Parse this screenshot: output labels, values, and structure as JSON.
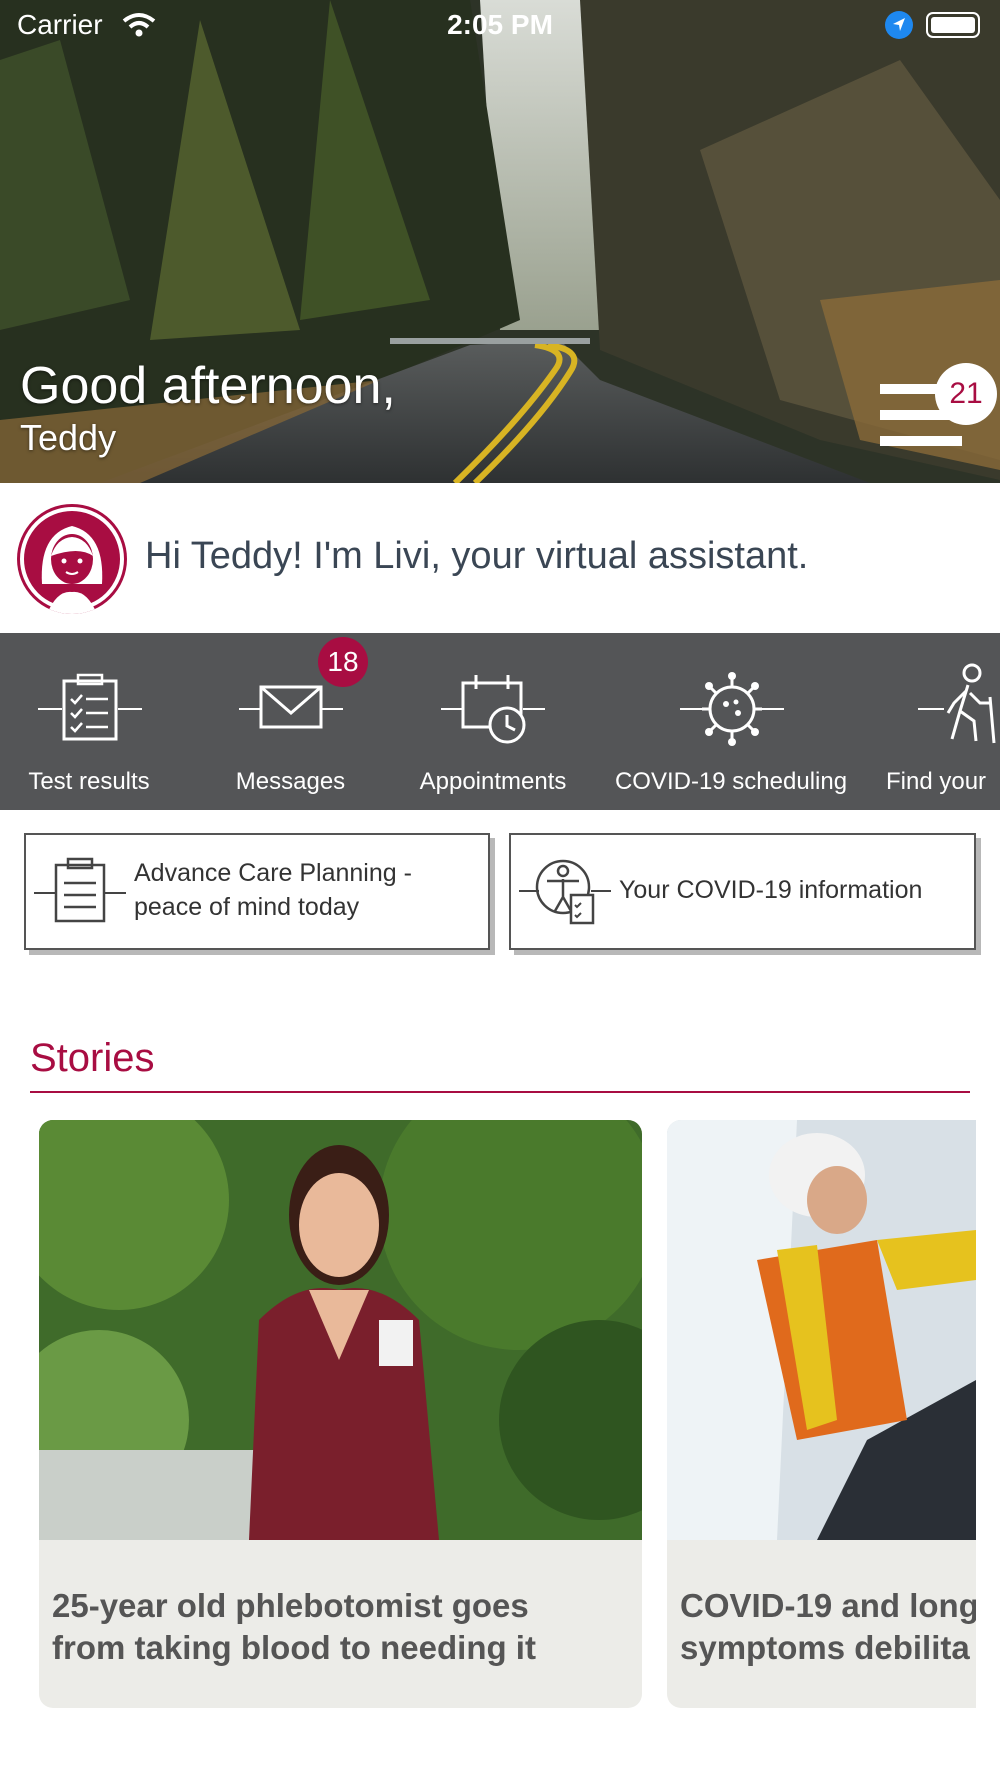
{
  "status_bar": {
    "carrier": "Carrier",
    "time": "2:05 PM"
  },
  "hero": {
    "greeting": "Good afternoon,",
    "name": "Teddy",
    "menu_badge": "21"
  },
  "assistant": {
    "text": "Hi Teddy! I'm Livi, your virtual assistant."
  },
  "quick_actions": [
    {
      "label": "Test results",
      "icon": "clipboard-checklist-icon"
    },
    {
      "label": "Messages",
      "icon": "envelope-icon",
      "badge": "18"
    },
    {
      "label": "Appointments",
      "icon": "calendar-clock-icon"
    },
    {
      "label": "COVID-19 scheduling",
      "icon": "virus-icon"
    },
    {
      "label": "Find your",
      "icon": "hiking-person-icon"
    }
  ],
  "cards": [
    {
      "label_line1": "Advance Care Planning -",
      "label_line2": "peace of mind today",
      "icon": "clipboard-list-icon"
    },
    {
      "label": "Your COVID-19 information",
      "icon": "person-checklist-icon"
    }
  ],
  "stories": {
    "title": "Stories",
    "items": [
      {
        "title_line1": "25-year old phlebotomist goes",
        "title_line2": "from taking blood to needing it"
      },
      {
        "title_line1": "COVID-19 and long",
        "title_line2": "symptoms debilita"
      }
    ]
  },
  "colors": {
    "brand": "#a80d42",
    "quick_actions_bg": "#545557",
    "story_card_bg": "#ecece8"
  }
}
